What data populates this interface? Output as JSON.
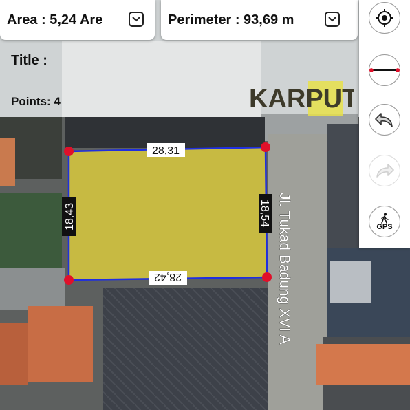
{
  "app": {
    "logo_text": "KARPUT"
  },
  "header": {
    "area": {
      "label": "Area : 5,24 Are",
      "icon": "chevron-down-icon"
    },
    "perimeter": {
      "label": "Perimeter : 93,69 m",
      "icon": "chevron-down-icon"
    }
  },
  "plot": {
    "title_label": "Title :",
    "points_label": "Points: 4",
    "fill_color": "#e5d33a",
    "line_color": "#1f2fe0",
    "vertex_color": "#e0102a",
    "sides": {
      "top": "28,31",
      "right": "18,54",
      "bottom": "28,42",
      "left": "18,43"
    }
  },
  "map": {
    "street_name": "Jl. Tukad Badung XVI A"
  },
  "toolbar": {
    "buttons": [
      {
        "id": "locate",
        "icon": "crosshair-locate-icon"
      },
      {
        "id": "measure",
        "icon": "measure-line-icon"
      },
      {
        "id": "undo",
        "icon": "undo-arrow-icon"
      },
      {
        "id": "redo",
        "icon": "redo-arrow-icon",
        "state": "disabled"
      },
      {
        "id": "gps",
        "icon": "walking-person-icon",
        "label": "GPS"
      }
    ]
  }
}
